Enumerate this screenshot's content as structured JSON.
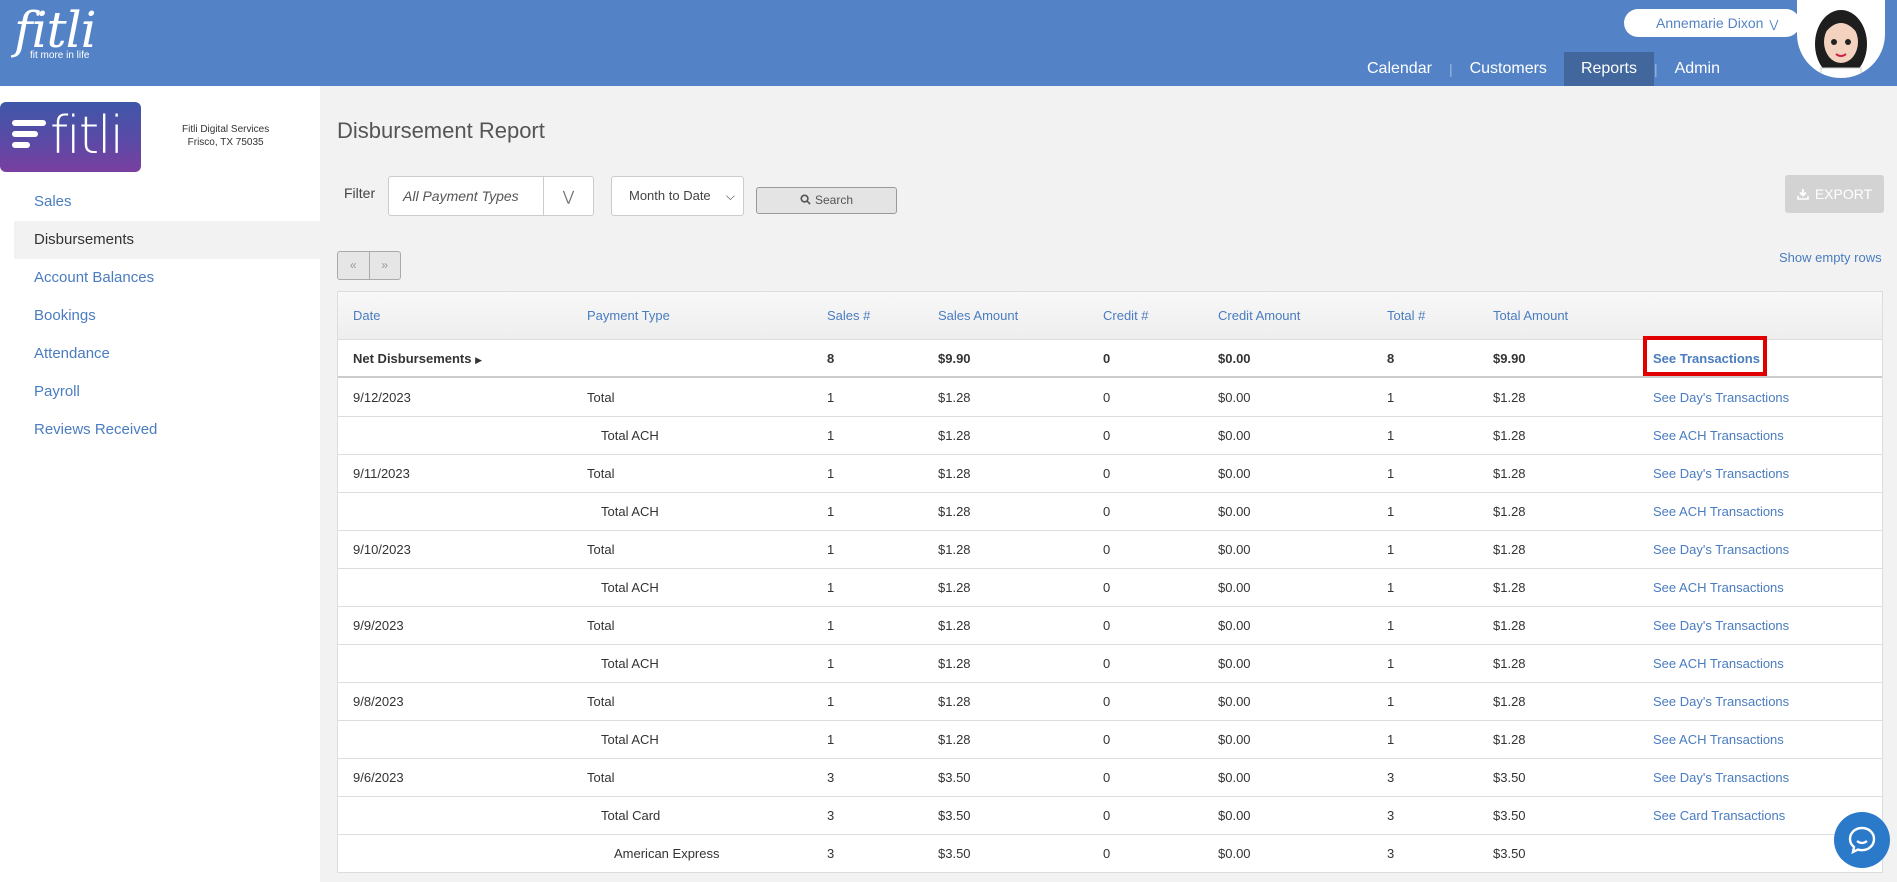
{
  "header": {
    "logo_text": "fitli",
    "logo_tagline": "fit more in life",
    "user_name": "Annemarie Dixon",
    "nav": [
      "Calendar",
      "Customers",
      "Reports",
      "Admin"
    ],
    "active_nav": "Reports"
  },
  "sidebar": {
    "brand_text": "fitli",
    "business_name": "Fitli Digital Services",
    "business_location": "Frisco, TX 75035",
    "items": [
      {
        "label": "Sales"
      },
      {
        "label": "Disbursements"
      },
      {
        "label": "Account Balances"
      },
      {
        "label": "Bookings"
      },
      {
        "label": "Attendance"
      },
      {
        "label": "Payroll"
      },
      {
        "label": "Reviews Received"
      }
    ],
    "active": "Disbursements"
  },
  "report": {
    "title": "Disbursement Report",
    "filter_label": "Filter",
    "payment_type_placeholder": "All Payment Types",
    "date_range": "Month to Date",
    "search_label": "Search",
    "export_label": "EXPORT",
    "pager_prev": "«",
    "pager_next": "»",
    "show_empty_rows": "Show empty rows"
  },
  "table": {
    "columns": [
      "Date",
      "Payment Type",
      "Sales #",
      "Sales Amount",
      "Credit #",
      "Credit Amount",
      "Total #",
      "Total Amount"
    ],
    "net": {
      "label": "Net Disbursements",
      "sales_count": "8",
      "sales_amount": "$9.90",
      "credit_count": "0",
      "credit_amount": "$0.00",
      "total_count": "8",
      "total_amount": "$9.90",
      "link": "See Transactions"
    },
    "rows": [
      {
        "date": "9/12/2023",
        "ptype": "Total",
        "sales_count": "1",
        "sales_amount": "$1.28",
        "credit_count": "0",
        "credit_amount": "$0.00",
        "total_count": "1",
        "total_amount": "$1.28",
        "link": "See Day's Transactions"
      },
      {
        "date": "",
        "ptype": "Total ACH",
        "sales_count": "1",
        "sales_amount": "$1.28",
        "credit_count": "0",
        "credit_amount": "$0.00",
        "total_count": "1",
        "total_amount": "$1.28",
        "link": "See ACH Transactions"
      },
      {
        "date": "9/11/2023",
        "ptype": "Total",
        "sales_count": "1",
        "sales_amount": "$1.28",
        "credit_count": "0",
        "credit_amount": "$0.00",
        "total_count": "1",
        "total_amount": "$1.28",
        "link": "See Day's Transactions"
      },
      {
        "date": "",
        "ptype": "Total ACH",
        "sales_count": "1",
        "sales_amount": "$1.28",
        "credit_count": "0",
        "credit_amount": "$0.00",
        "total_count": "1",
        "total_amount": "$1.28",
        "link": "See ACH Transactions"
      },
      {
        "date": "9/10/2023",
        "ptype": "Total",
        "sales_count": "1",
        "sales_amount": "$1.28",
        "credit_count": "0",
        "credit_amount": "$0.00",
        "total_count": "1",
        "total_amount": "$1.28",
        "link": "See Day's Transactions"
      },
      {
        "date": "",
        "ptype": "Total ACH",
        "sales_count": "1",
        "sales_amount": "$1.28",
        "credit_count": "0",
        "credit_amount": "$0.00",
        "total_count": "1",
        "total_amount": "$1.28",
        "link": "See ACH Transactions"
      },
      {
        "date": "9/9/2023",
        "ptype": "Total",
        "sales_count": "1",
        "sales_amount": "$1.28",
        "credit_count": "0",
        "credit_amount": "$0.00",
        "total_count": "1",
        "total_amount": "$1.28",
        "link": "See Day's Transactions"
      },
      {
        "date": "",
        "ptype": "Total ACH",
        "sales_count": "1",
        "sales_amount": "$1.28",
        "credit_count": "0",
        "credit_amount": "$0.00",
        "total_count": "1",
        "total_amount": "$1.28",
        "link": "See ACH Transactions"
      },
      {
        "date": "9/8/2023",
        "ptype": "Total",
        "sales_count": "1",
        "sales_amount": "$1.28",
        "credit_count": "0",
        "credit_amount": "$0.00",
        "total_count": "1",
        "total_amount": "$1.28",
        "link": "See Day's Transactions"
      },
      {
        "date": "",
        "ptype": "Total ACH",
        "sales_count": "1",
        "sales_amount": "$1.28",
        "credit_count": "0",
        "credit_amount": "$0.00",
        "total_count": "1",
        "total_amount": "$1.28",
        "link": "See ACH Transactions"
      },
      {
        "date": "9/6/2023",
        "ptype": "Total",
        "sales_count": "3",
        "sales_amount": "$3.50",
        "credit_count": "0",
        "credit_amount": "$0.00",
        "total_count": "3",
        "total_amount": "$3.50",
        "link": "See Day's Transactions"
      },
      {
        "date": "",
        "ptype": "Total Card",
        "sales_count": "3",
        "sales_amount": "$3.50",
        "credit_count": "0",
        "credit_amount": "$0.00",
        "total_count": "3",
        "total_amount": "$3.50",
        "link": "See Card Transactions"
      },
      {
        "date": "",
        "ptype": "American Express",
        "sales_count": "3",
        "sales_amount": "$3.50",
        "credit_count": "0",
        "credit_amount": "$0.00",
        "total_count": "3",
        "total_amount": "$3.50",
        "link": ""
      }
    ]
  },
  "colors": {
    "header_blue": "#5383c6",
    "active_nav": "#41679c",
    "link_blue": "#4a7cc0",
    "highlight_red": "#e10000"
  }
}
